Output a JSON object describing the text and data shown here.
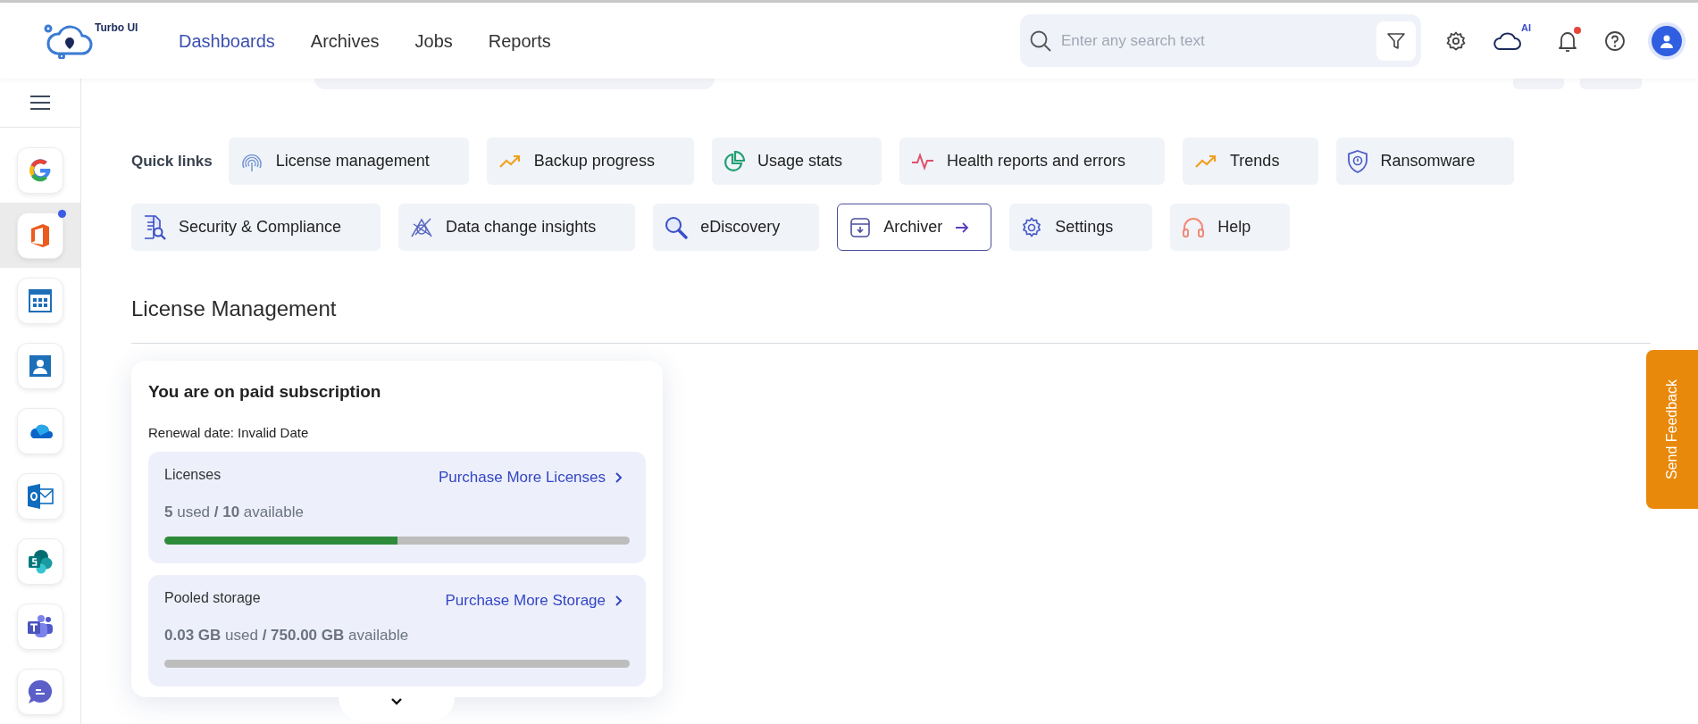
{
  "brand": {
    "name": "Turbo UI"
  },
  "nav": [
    {
      "label": "Dashboards",
      "selected": true
    },
    {
      "label": "Archives",
      "selected": false
    },
    {
      "label": "Jobs",
      "selected": false
    },
    {
      "label": "Reports",
      "selected": false
    }
  ],
  "search": {
    "placeholder": "Enter any search text"
  },
  "toolbar": {
    "ai_badge": "AI",
    "notification": true
  },
  "sidebar": {
    "apps": [
      {
        "kind": "google",
        "selected": false,
        "badge": false
      },
      {
        "kind": "office",
        "selected": true,
        "badge": true
      },
      {
        "kind": "calendar",
        "selected": false,
        "badge": false
      },
      {
        "kind": "contacts",
        "selected": false,
        "badge": false
      },
      {
        "kind": "onedrive",
        "selected": false,
        "badge": false
      },
      {
        "kind": "outlook",
        "selected": false,
        "badge": false
      },
      {
        "kind": "sharepoint",
        "selected": false,
        "badge": false
      },
      {
        "kind": "teams",
        "selected": false,
        "badge": false
      },
      {
        "kind": "chat",
        "selected": false,
        "badge": false
      }
    ]
  },
  "quick_links": {
    "label": "Quick links",
    "items": [
      {
        "kind": "license",
        "label": "License management",
        "selected": false
      },
      {
        "kind": "backup",
        "label": "Backup progress",
        "selected": false
      },
      {
        "kind": "usage",
        "label": "Usage stats",
        "selected": false
      },
      {
        "kind": "health",
        "label": "Health reports and errors",
        "selected": false
      },
      {
        "kind": "trends",
        "label": "Trends",
        "selected": false
      },
      {
        "kind": "ransomware",
        "label": "Ransomware",
        "selected": false
      },
      {
        "kind": "security",
        "label": "Security & Compliance",
        "selected": false
      },
      {
        "kind": "datachange",
        "label": "Data change insights",
        "selected": false
      },
      {
        "kind": "ediscovery",
        "label": "eDiscovery",
        "selected": false
      },
      {
        "kind": "archiver",
        "label": "Archiver",
        "selected": true
      },
      {
        "kind": "settings",
        "label": "Settings",
        "selected": false
      },
      {
        "kind": "help",
        "label": "Help",
        "selected": false
      }
    ]
  },
  "section": {
    "title": "License Management"
  },
  "subscription": {
    "title": "You are on paid subscription",
    "renewal": "Renewal date: Invalid Date",
    "meters": [
      {
        "name": "Licenses",
        "link": "Purchase More Licenses",
        "usage": "**5** used **/ 10** available",
        "level": 0.5
      },
      {
        "name": "Pooled storage",
        "link": "Purchase More Storage",
        "usage": "**0.03 GB** used **/ 750.00 GB** available",
        "level": 0
      }
    ]
  },
  "feedback": {
    "label": "Send Feedback"
  }
}
